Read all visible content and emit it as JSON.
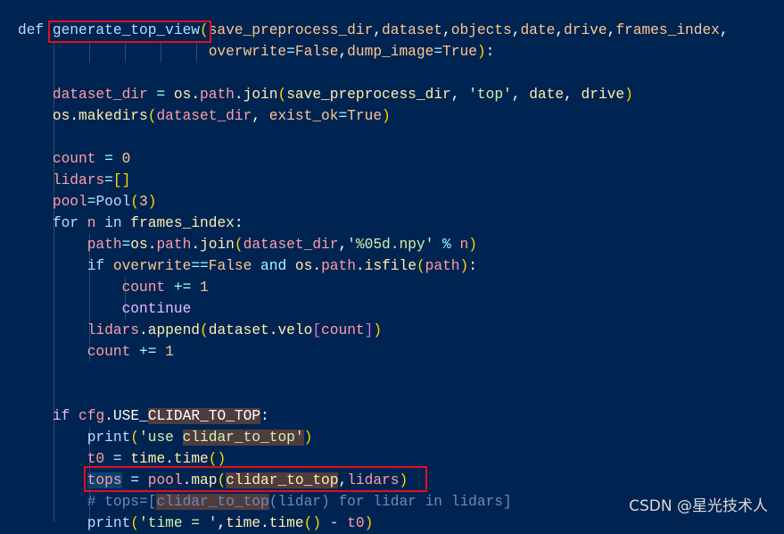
{
  "theme": {
    "background": "#002451",
    "highlight_box": "#e0101e"
  },
  "code_lines": [
    [
      [
        "k",
        "def "
      ],
      [
        "f",
        "generate_top_view"
      ],
      [
        "b",
        "("
      ],
      [
        "p",
        "save_preprocess_dir"
      ],
      [
        "w",
        ","
      ],
      [
        "p",
        "dataset"
      ],
      [
        "w",
        ","
      ],
      [
        "p",
        "objects"
      ],
      [
        "w",
        ","
      ],
      [
        "p",
        "date"
      ],
      [
        "w",
        ","
      ],
      [
        "p",
        "drive"
      ],
      [
        "w",
        ","
      ],
      [
        "p",
        "frames_index"
      ],
      [
        "w",
        ","
      ]
    ],
    [
      [
        "w",
        "                      "
      ],
      [
        "p",
        "overwrite"
      ],
      [
        "o",
        "="
      ],
      [
        "n",
        "False"
      ],
      [
        "w",
        ","
      ],
      [
        "p",
        "dump_image"
      ],
      [
        "o",
        "="
      ],
      [
        "n",
        "True"
      ],
      [
        "b",
        ")"
      ],
      [
        "w",
        ":"
      ]
    ],
    [],
    [
      [
        "w",
        "    "
      ],
      [
        "v",
        "dataset_dir"
      ],
      [
        "o",
        " = "
      ],
      [
        "a",
        "os"
      ],
      [
        "w",
        "."
      ],
      [
        "v",
        "path"
      ],
      [
        "w",
        "."
      ],
      [
        "a",
        "join"
      ],
      [
        "b",
        "("
      ],
      [
        "a",
        "save_preprocess_dir"
      ],
      [
        "w",
        ", "
      ],
      [
        "s",
        "'top'"
      ],
      [
        "w",
        ", "
      ],
      [
        "a",
        "date"
      ],
      [
        "w",
        ", "
      ],
      [
        "a",
        "drive"
      ],
      [
        "b",
        ")"
      ]
    ],
    [
      [
        "w",
        "    "
      ],
      [
        "a",
        "os"
      ],
      [
        "w",
        "."
      ],
      [
        "a",
        "makedirs"
      ],
      [
        "b",
        "("
      ],
      [
        "v",
        "dataset_dir"
      ],
      [
        "w",
        ", "
      ],
      [
        "p",
        "exist_ok"
      ],
      [
        "o",
        "="
      ],
      [
        "n",
        "True"
      ],
      [
        "b",
        ")"
      ]
    ],
    [],
    [
      [
        "w",
        "    "
      ],
      [
        "v",
        "count"
      ],
      [
        "o",
        " = "
      ],
      [
        "n",
        "0"
      ]
    ],
    [
      [
        "w",
        "    "
      ],
      [
        "v",
        "lidars"
      ],
      [
        "o",
        "="
      ],
      [
        "b",
        "[]"
      ]
    ],
    [
      [
        "w",
        "    "
      ],
      [
        "v",
        "pool"
      ],
      [
        "o",
        "="
      ],
      [
        "f",
        "Pool"
      ],
      [
        "b",
        "("
      ],
      [
        "n",
        "3"
      ],
      [
        "b",
        ")"
      ]
    ],
    [
      [
        "w",
        "    "
      ],
      [
        "k",
        "for "
      ],
      [
        "v",
        "n"
      ],
      [
        "k",
        " in "
      ],
      [
        "a",
        "frames_index"
      ],
      [
        "w",
        ":"
      ]
    ],
    [
      [
        "w",
        "        "
      ],
      [
        "v",
        "path"
      ],
      [
        "o",
        "="
      ],
      [
        "a",
        "os"
      ],
      [
        "w",
        "."
      ],
      [
        "v",
        "path"
      ],
      [
        "w",
        "."
      ],
      [
        "a",
        "join"
      ],
      [
        "b",
        "("
      ],
      [
        "v",
        "dataset_dir"
      ],
      [
        "w",
        ","
      ],
      [
        "s",
        "'%05d.npy'"
      ],
      [
        "o",
        " % "
      ],
      [
        "v",
        "n"
      ],
      [
        "b",
        ")"
      ]
    ],
    [
      [
        "w",
        "        "
      ],
      [
        "k",
        "if "
      ],
      [
        "p",
        "overwrite"
      ],
      [
        "o",
        "=="
      ],
      [
        "n",
        "False"
      ],
      [
        "o",
        " and "
      ],
      [
        "a",
        "os"
      ],
      [
        "w",
        "."
      ],
      [
        "v",
        "path"
      ],
      [
        "w",
        "."
      ],
      [
        "a",
        "isfile"
      ],
      [
        "b",
        "("
      ],
      [
        "v",
        "path"
      ],
      [
        "b",
        ")"
      ],
      [
        "w",
        ":"
      ]
    ],
    [
      [
        "w",
        "            "
      ],
      [
        "v",
        "count"
      ],
      [
        "o",
        " += "
      ],
      [
        "n",
        "1"
      ]
    ],
    [
      [
        "w",
        "            "
      ],
      [
        "kw",
        "continue"
      ]
    ],
    [
      [
        "w",
        "        "
      ],
      [
        "v",
        "lidars"
      ],
      [
        "w",
        "."
      ],
      [
        "a",
        "append"
      ],
      [
        "b",
        "("
      ],
      [
        "a",
        "dataset"
      ],
      [
        "w",
        "."
      ],
      [
        "a",
        "velo"
      ],
      [
        "b2",
        "["
      ],
      [
        "v",
        "count"
      ],
      [
        "b2",
        "]"
      ],
      [
        "b",
        ")"
      ]
    ],
    [
      [
        "w",
        "        "
      ],
      [
        "v",
        "count"
      ],
      [
        "o",
        " += "
      ],
      [
        "n",
        "1"
      ]
    ],
    [],
    [],
    [
      [
        "w",
        "    "
      ],
      [
        "kw",
        "if "
      ],
      [
        "v",
        "cfg"
      ],
      [
        "w",
        "."
      ],
      [
        "w",
        "USE_"
      ],
      [
        "w hb",
        "CLIDAR_TO_TOP"
      ],
      [
        "w",
        ":"
      ]
    ],
    [
      [
        "w",
        "        "
      ],
      [
        "f",
        "print"
      ],
      [
        "b",
        "("
      ],
      [
        "s",
        "'use "
      ],
      [
        "s hb",
        "clidar_to_top"
      ],
      [
        "s hb",
        "'"
      ],
      [
        "b",
        ")"
      ]
    ],
    [
      [
        "w",
        "        "
      ],
      [
        "v",
        "t0"
      ],
      [
        "o",
        " = "
      ],
      [
        "a",
        "time"
      ],
      [
        "w",
        "."
      ],
      [
        "a",
        "time"
      ],
      [
        "b",
        "()"
      ]
    ],
    [
      [
        "w",
        "        "
      ],
      [
        "v hs",
        "tops"
      ],
      [
        "o",
        " = "
      ],
      [
        "v",
        "pool"
      ],
      [
        "w",
        "."
      ],
      [
        "a",
        "map"
      ],
      [
        "b",
        "("
      ],
      [
        "a hb",
        "clidar_to_top"
      ],
      [
        "w",
        ","
      ],
      [
        "v",
        "lidars"
      ],
      [
        "b",
        ")"
      ]
    ],
    [
      [
        "w",
        "        "
      ],
      [
        "c",
        "# tops=["
      ],
      [
        "c hb",
        "clidar_to_top"
      ],
      [
        "c",
        "(lidar) for lidar in lidars]"
      ]
    ],
    [
      [
        "w",
        "        "
      ],
      [
        "f",
        "print"
      ],
      [
        "b",
        "("
      ],
      [
        "s",
        "'time = '"
      ],
      [
        "w",
        ","
      ],
      [
        "a",
        "time"
      ],
      [
        "w",
        "."
      ],
      [
        "a",
        "time"
      ],
      [
        "b",
        "()"
      ],
      [
        "o",
        " - "
      ],
      [
        "v",
        "t0"
      ],
      [
        "b",
        ")"
      ]
    ]
  ],
  "watermark": "CSDN @星光技术人"
}
